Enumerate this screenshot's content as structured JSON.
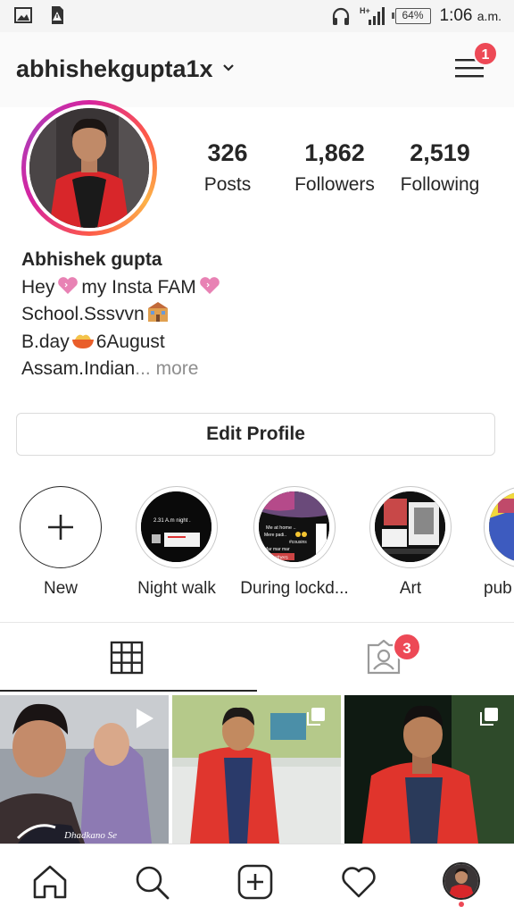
{
  "status_bar": {
    "battery": "64%",
    "time": "1:06",
    "time_suffix": "a.m.",
    "network": "H+",
    "icons": [
      "image-icon",
      "sim-alert-icon",
      "headphones-icon",
      "signal-icon",
      "battery-icon"
    ]
  },
  "header": {
    "username": "abhishekgupta1x",
    "menu_badge": "1"
  },
  "stats": [
    {
      "value": "326",
      "label": "Posts"
    },
    {
      "value": "1,862",
      "label": "Followers"
    },
    {
      "value": "2,519",
      "label": "Following"
    }
  ],
  "bio": {
    "name": "Abhishek gupta",
    "line1_a": "Hey",
    "line1_b": "my Insta FAM",
    "line2": "School.Sssvvn",
    "line3_a": "B.day",
    "line3_b": "6August",
    "line4": "Assam.Indian",
    "more": "... more"
  },
  "edit_profile": "Edit Profile",
  "highlights": [
    {
      "label": "New",
      "text": []
    },
    {
      "label": "Night walk",
      "text": [
        "2.31 A.m night ."
      ]
    },
    {
      "label": "During lockd...",
      "text": [
        "Me at home ..",
        "Mere padi..",
        "#cousins",
        "Mar mar mar",
        "Brothers"
      ]
    },
    {
      "label": "Art",
      "text": []
    },
    {
      "label": "pub",
      "text": []
    }
  ],
  "tabs": {
    "tagged_badge": "3"
  },
  "posts": [
    {
      "caption": "Dhadkano Se"
    },
    {
      "caption": ""
    },
    {
      "caption": ""
    }
  ],
  "bottom_nav": [
    "home-icon",
    "search-icon",
    "new-post-icon",
    "activity-heart-icon",
    "profile-avatar-icon"
  ],
  "colors": {
    "accent_red": "#ed4956",
    "text": "#262626",
    "muted": "#8e8e8e",
    "story_ring_start": "#d6249f",
    "story_ring_end": "#fdb247"
  }
}
